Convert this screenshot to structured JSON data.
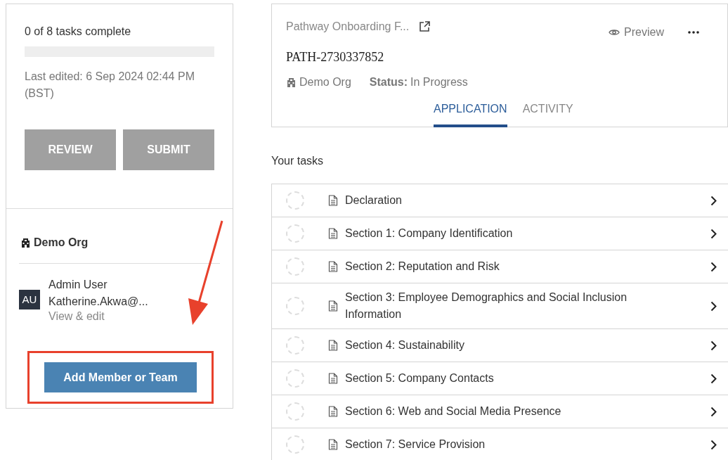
{
  "progress": {
    "summary": "0 of 8 tasks complete",
    "level": 0,
    "last_edited": "Last edited: 6 Sep 2024 02:44 PM (BST)",
    "buttons": [
      {
        "label": "REVIEW",
        "disabled": true
      },
      {
        "label": "SUBMIT",
        "disabled": true
      }
    ]
  },
  "organization": {
    "name": "Demo Org",
    "member": {
      "initials": "AU",
      "name": "Admin User",
      "email": "Katherine.Akwa@...",
      "link": "View & edit"
    },
    "add_button": "Add Member or Team",
    "highlighted": true
  },
  "header": {
    "title": "Pathway Onboarding F...",
    "preview": "Preview",
    "reference": "PATH-2730337852",
    "org": "Demo Org",
    "status_label": "Status:",
    "status": "In Progress",
    "tabs": [
      {
        "label": "APPLICATION",
        "selected": true
      },
      {
        "label": "ACTIVITY",
        "selected": false
      }
    ]
  },
  "tasks": {
    "heading": "Your tasks",
    "items": [
      {
        "label": "Declaration",
        "complete": false
      },
      {
        "label": "Section 1: Company Identification",
        "complete": false
      },
      {
        "label": "Section 2: Reputation and Risk",
        "complete": false
      },
      {
        "label": "Section 3: Employee Demographics and Social Inclusion Information",
        "complete": false
      },
      {
        "label": "Section 4: Sustainability",
        "complete": false
      },
      {
        "label": "Section 5: Company Contacts",
        "complete": false
      },
      {
        "label": "Section 6: Web and Social Media Presence",
        "complete": false
      },
      {
        "label": "Section 7: Service Provision",
        "complete": false
      }
    ]
  }
}
